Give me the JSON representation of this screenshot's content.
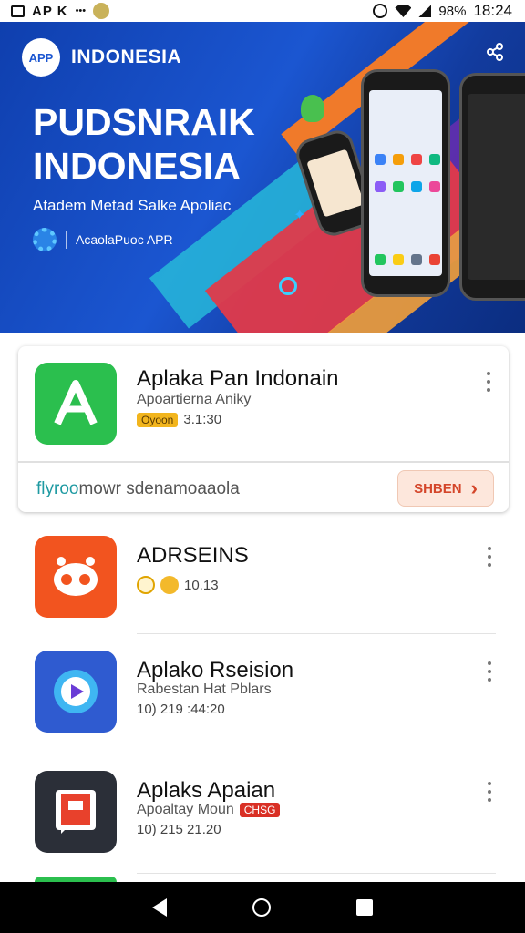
{
  "status_bar": {
    "carrier": "AP K",
    "small_text": "•••",
    "battery": "98%",
    "time": "18:24"
  },
  "banner": {
    "logo_text": "APP",
    "brand_name": "INDONESIA",
    "title_line1": "PUDSNRAIK",
    "title_line2": "INDONESIA",
    "subtitle": "Atadem Metad Salke Apoliac",
    "footer_text": "AcaolaPuoc APR"
  },
  "apps": [
    {
      "title": "Aplaka Pan Indonain",
      "subtitle": "Apoartierna Aniky",
      "badge": "Oyoon",
      "meta": "3.1:30",
      "icon_letter": "A",
      "icon_color": "#2bbf4e"
    },
    {
      "title": "ADRSEINS",
      "meta": "10.13",
      "icon_color": "#f2541f"
    },
    {
      "title": "Aplako Rseision",
      "subtitle": "Rabestan Hat Pblars",
      "meta": "10) 219 :44:20",
      "icon_color": "#2f5bd0"
    },
    {
      "title": "Aplaks Apaian",
      "subtitle": "Apoaltay Moun",
      "badge": "CHSG",
      "meta": "10) 215 21.20",
      "icon_color": "#2b2f38"
    }
  ],
  "card": {
    "link_accent": "flyroo",
    "link_rest": "mowr sdenamoaaola",
    "button_label": "SHBEN",
    "button_chevron": "›"
  },
  "icons": {
    "share": "share-icon",
    "more": "more-vert-icon",
    "back": "nav-back-icon",
    "home": "nav-home-icon",
    "recent": "nav-recent-icon"
  },
  "colors": {
    "banner_blue": "#1b56d1",
    "accent_red": "#d4462a",
    "accent_teal": "#1f9aa2"
  }
}
